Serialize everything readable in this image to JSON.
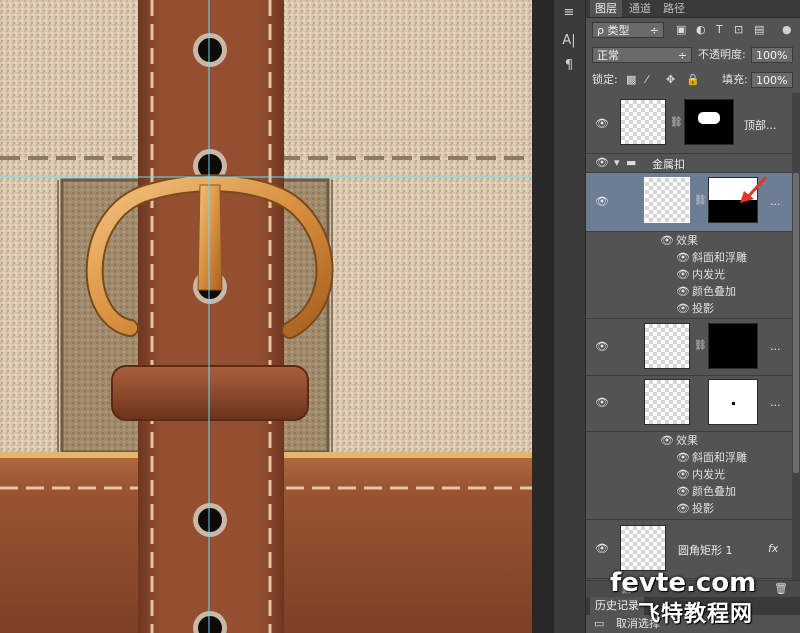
{
  "tabs": [
    {
      "label": "图层",
      "active": true
    },
    {
      "label": "通道",
      "active": false
    },
    {
      "label": "路径",
      "active": false
    }
  ],
  "filter": {
    "label": "ρ 类型"
  },
  "blend": {
    "mode": "正常",
    "opacity_label": "不透明度:",
    "opacity_value": "100%"
  },
  "lock": {
    "label": "锁定:",
    "fill_label": "填充:",
    "fill_value": "100%"
  },
  "layers": {
    "top_layer": {
      "name": "顶部..."
    },
    "group": {
      "name": "金属扣"
    },
    "effects_label": "效果",
    "effects": [
      "斜面和浮雕",
      "内发光",
      "颜色叠加",
      "投影"
    ],
    "rounded_rect": {
      "name": "圆角矩形 1",
      "fx": "fx"
    }
  },
  "history": {
    "tab": "历史记录",
    "item": "取消选择"
  },
  "watermark": {
    "line1": "fevte.com",
    "line2": "飞特教程网"
  },
  "tool_strip": {
    "t1": "A|",
    "t2": "¶"
  },
  "colors": {
    "panel_bg": "#535353",
    "selected_layer": "#6d7d93",
    "leather": "#8a4a2c",
    "canvas_fabric": "#d9c9b3",
    "buckle_gold": "#e2a65a",
    "arrow_red": "#e0362c"
  }
}
